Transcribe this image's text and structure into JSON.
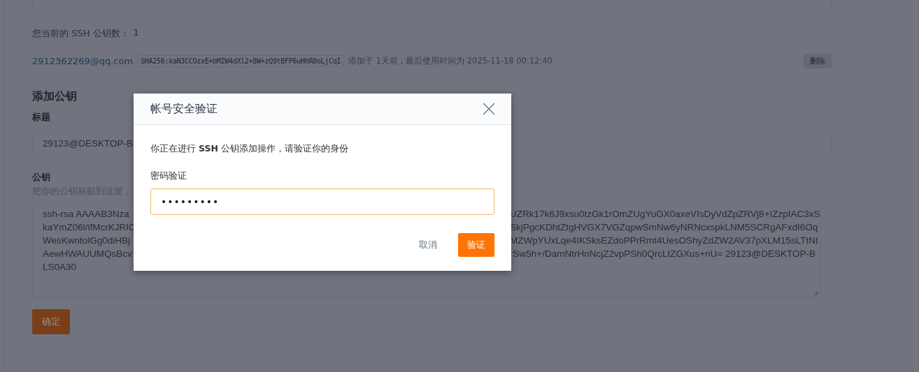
{
  "ssh_keys": {
    "count_label": "您当前的 SSH 公钥数：",
    "count": "1",
    "keys": [
      {
        "email": "2912362269@qq.com",
        "fingerprint": "SHA256:kaN3CCOzxE+bMIW4dXl2+8W+zQ9tBFP6uHhR0oLjCqI",
        "added": "添加于 1天前 , 最后使用时间为 2025-11-18 00:12:40",
        "delete": "删除"
      }
    ]
  },
  "add_key": {
    "heading": "添加公钥",
    "title_label": "标题",
    "title_value": "29123@DESKTOP-B",
    "key_label": "公钥",
    "key_hint": "把你的公钥粘贴到这里，",
    "key_lines": [
      {
        "left": "ssh-rsa AAAAB3Nza",
        "right": "UZRk17k6J9xsu0tzGk1rOmZUgYuGX0axeVIsDyVdZpZRVj8+IZzpIAC3xS"
      },
      {
        "left": "kaYmZ06l/ifMcrKJRIC",
        "right": "SkjPgcKDhtZtgHVGX7VGZqpwSmNw6yNRNcxspkLNM5SCRgAFxdI6Oq"
      },
      {
        "left": "WesKwntolGg0diHBj",
        "right": "MZWpYUxLqe4IKSksEZdoPPrRmt4UesOShyZdZW2AV37pXLM15sLTtNI"
      },
      {
        "left": "AewHWAUUMQsBcv",
        "right": "rSw5h+/DamNtrHnNcjZ2vpPSh0QrcLtZGXus+nU= 29123@DESKTOP-B"
      },
      {
        "left": "LS0A30"
      }
    ],
    "submit": "确定"
  },
  "dialog": {
    "title": "帐号安全验证",
    "message": "你正在进行 **SSH** 公钥添加操作，请验证你的身份",
    "password_label": "密码验证",
    "password_value": "•••••••••",
    "cancel": "取消",
    "confirm": "验证"
  }
}
